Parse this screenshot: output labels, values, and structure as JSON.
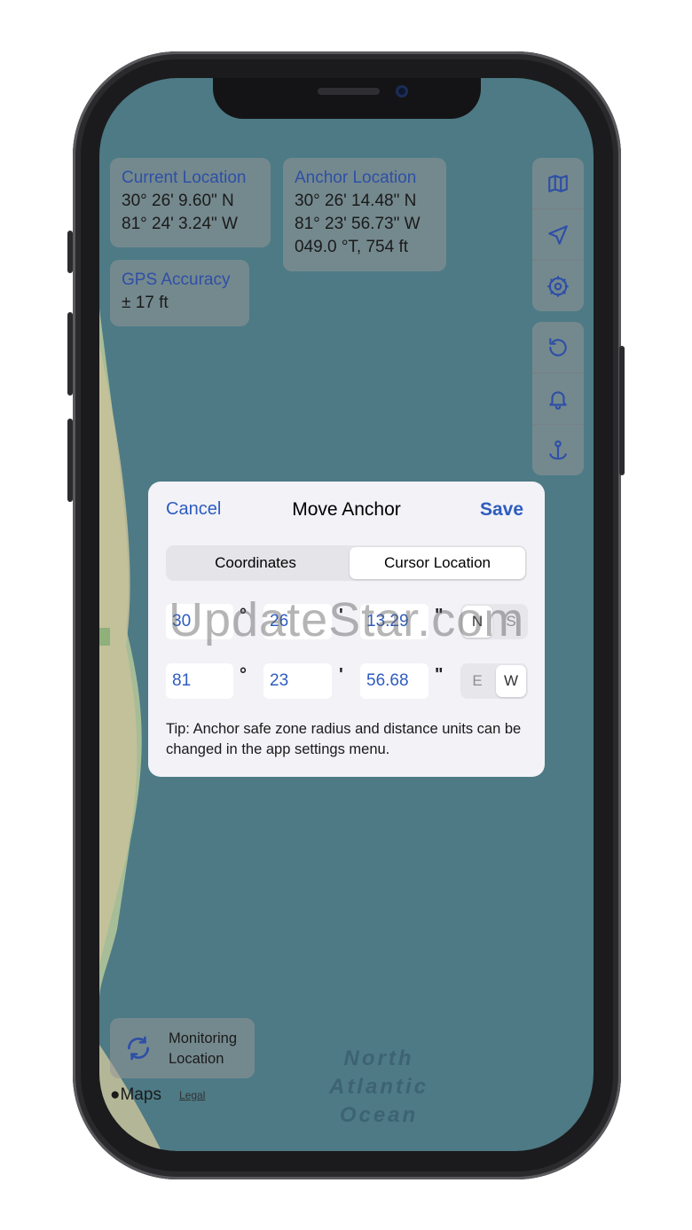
{
  "location_card": {
    "title": "Current Location",
    "lat": "30° 26' 9.60\" N",
    "lon": "81° 24' 3.24\" W"
  },
  "anchor_card": {
    "title": "Anchor Location",
    "lat": "30° 26' 14.48\" N",
    "lon": "81° 23' 56.73\" W",
    "bearing": "049.0 °T,  754 ft"
  },
  "gps_card": {
    "title": "GPS Accuracy",
    "value": "± 17 ft"
  },
  "controls_top": [
    "map-icon",
    "location-arrow-icon",
    "settings-gear-icon"
  ],
  "controls_bottom": [
    "reset-icon",
    "bell-icon",
    "anchor-drop-icon"
  ],
  "modal": {
    "cancel": "Cancel",
    "title": "Move Anchor",
    "save": "Save",
    "segments": [
      {
        "label": "Coordinates",
        "selected": false
      },
      {
        "label": "Cursor Location",
        "selected": true
      }
    ],
    "lat": {
      "deg": "30",
      "min": "26",
      "sec": "13.29",
      "hemi": [
        "N",
        "S"
      ],
      "selected": "N"
    },
    "lon": {
      "deg": "81",
      "min": "23",
      "sec": "56.68",
      "hemi": [
        "E",
        "W"
      ],
      "selected": "W"
    },
    "units": {
      "deg": "°",
      "min": "'",
      "sec": "\""
    },
    "tip": "Tip: Anchor safe zone radius and distance units can be changed in the app settings menu."
  },
  "monitor": {
    "line1": "Monitoring",
    "line2": "Location",
    "icon": "sync-icon"
  },
  "map_attr": {
    "brand": "Maps",
    "legal": "Legal"
  },
  "ocean_label": [
    "North",
    "Atlantic",
    "Ocean"
  ],
  "watermark": "UpdateStar.com"
}
